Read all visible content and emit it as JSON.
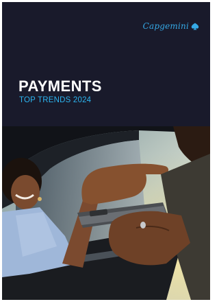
{
  "brand": {
    "name": "Capgemini",
    "logo_icon": "spade-icon",
    "color": "#35a9e6"
  },
  "cover": {
    "title": "PAYMENTS",
    "subtitle": "TOP TRENDS 2024",
    "background": "#191a2b",
    "subtitle_color": "#2cb4ef"
  },
  "photo": {
    "subject_icon": "card-terminal-photo"
  }
}
